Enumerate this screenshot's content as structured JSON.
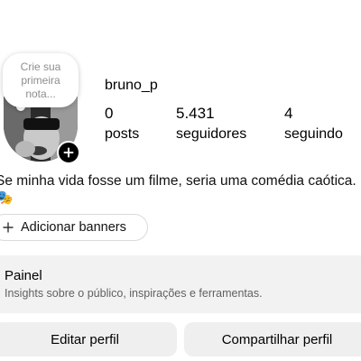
{
  "note": {
    "placeholder": "Crie sua primeira nota..."
  },
  "profile": {
    "username": "bruno_p",
    "stats": {
      "posts": {
        "count": "0",
        "label": "posts"
      },
      "followers": {
        "count": "5.431",
        "label": "seguidores"
      },
      "following": {
        "count": "4",
        "label": "seguindo"
      }
    },
    "bio": "Se minha vida fosse um filme, seria uma comédia caótica. 🎭"
  },
  "banners": {
    "label": "Adicionar banners",
    "icon": "plus-icon"
  },
  "dashboard": {
    "title": "Painel",
    "subtitle": "Insights sobre o público, inspirações e ferramentas."
  },
  "actions": {
    "edit_label": "Editar perfil",
    "share_label": "Compartilhar perfil"
  },
  "colors": {
    "button_bg": "#efefef",
    "card_bg": "#f2f2f2",
    "muted_text": "#8e8e8e"
  }
}
